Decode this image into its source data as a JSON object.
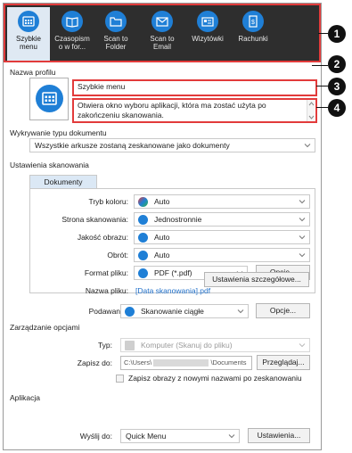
{
  "toolbar": {
    "items": [
      {
        "label": "Szybkie menu",
        "icon": "quick-menu-icon"
      },
      {
        "label": "Czasopism o w for...",
        "icon": "magazine-icon"
      },
      {
        "label": "Scan to Folder",
        "icon": "folder-icon"
      },
      {
        "label": "Scan to Email",
        "icon": "email-icon"
      },
      {
        "label": "Wizytówki",
        "icon": "business-card-icon"
      },
      {
        "label": "Rachunki",
        "icon": "receipt-icon"
      }
    ]
  },
  "profile": {
    "section_label": "Nazwa profilu",
    "name_value": "Szybkie menu",
    "description": "Otwiera okno wyboru aplikacji, która ma zostać użyta po zakończeniu skanowania."
  },
  "doc_detect": {
    "label": "Wykrywanie typu dokumentu",
    "value": "Wszystkie arkusze zostaną zeskanowane jako dokumenty"
  },
  "scan_settings": {
    "label": "Ustawienia skanowania",
    "tab": "Dokumenty",
    "color_mode": {
      "label": "Tryb koloru:",
      "value": "Auto"
    },
    "scan_side": {
      "label": "Strona skanowania:",
      "value": "Jednostronnie"
    },
    "quality": {
      "label": "Jakość obrazu:",
      "value": "Auto"
    },
    "rotation": {
      "label": "Obrót:",
      "value": "Auto"
    },
    "file_format": {
      "label": "Format pliku:",
      "value": "PDF (*.pdf)",
      "options_button": "Opcje..."
    },
    "file_name": {
      "label": "Nazwa pliku:",
      "value": "[Data skanowania].pdf"
    },
    "advanced_button": "Ustawienia szczegółowe..."
  },
  "feed": {
    "label": "Podawanie:",
    "value": "Skanowanie ciągłe",
    "options_button": "Opcje..."
  },
  "options_mgmt": {
    "label": "Zarządzanie opcjami",
    "type_label": "Typ:",
    "type_value": "Komputer (Skanuj do pliku)",
    "save_label": "Zapisz do:",
    "save_prefix": "C:\\Users\\",
    "save_suffix": "\\Documents",
    "browse_button": "Przeglądaj...",
    "checkbox_label": "Zapisz obrazy z nowymi nazwami po zeskanowaniu"
  },
  "app": {
    "label": "Aplikacja",
    "send_label": "Wyślij do:",
    "send_value": "Quick Menu",
    "settings_button": "Ustawienia..."
  },
  "callouts": [
    "1",
    "2",
    "3",
    "4"
  ],
  "colors": {
    "accent": "#1f7fd6",
    "highlight": "#e23b3b",
    "toolbar_bg": "#2e2e2e"
  }
}
